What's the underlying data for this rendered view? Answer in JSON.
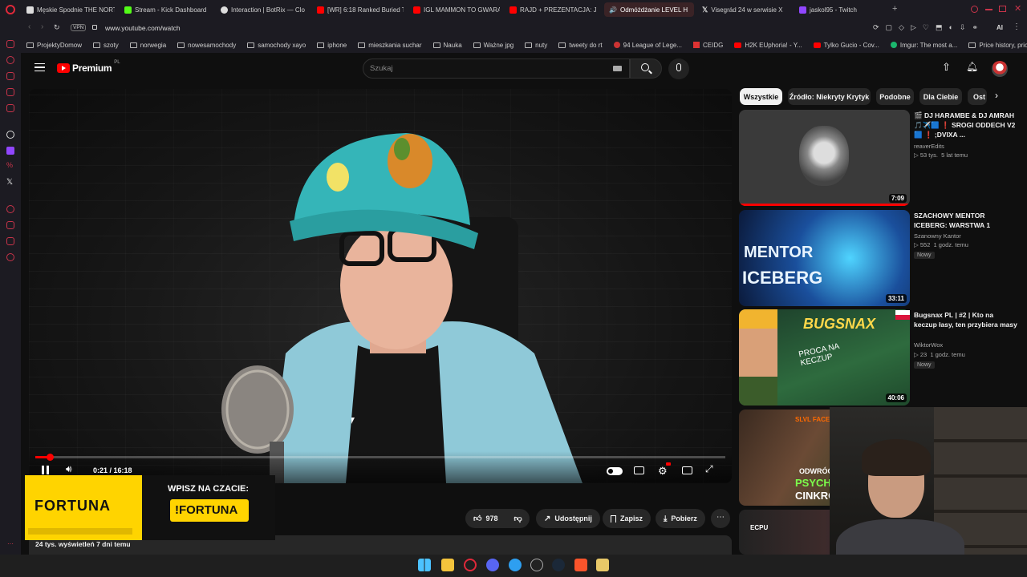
{
  "browser": {
    "tabs": [
      {
        "label": "Męskie Spodnie THE NORT",
        "color": "#222222"
      },
      {
        "label": "Stream - Kick Dashboard",
        "color": "#53fc18"
      },
      {
        "label": "Interaction | BotRix — Clo",
        "color": "#dddddd"
      },
      {
        "label": "[WR] 6:18 Ranked Buried T",
        "color": "#ff0000"
      },
      {
        "label": "IGL MAMMON TO GWARAN",
        "color": "#ff0000"
      },
      {
        "label": "RAJD + PREZENTACJA: Ja",
        "color": "#ff0000"
      },
      {
        "label": "Odmóżdżanie LEVEL H",
        "color": "#ff0000"
      },
      {
        "label": "Visegrád 24 w serwisie X",
        "color": "#ffffff"
      },
      {
        "label": "jaskol95 - Twitch",
        "color": "#9146ff"
      }
    ],
    "vpn_label": "VPN",
    "url": "www.youtube.com/watch",
    "ai_label": "AI",
    "bookmarks": [
      "ProjektyDomow",
      "szoty",
      "norwegia",
      "nowesamochody",
      "samochody xayo",
      "iphone",
      "mieszkania suchar",
      "Nauka",
      "Ważne jpg",
      "nuty",
      "tweety do rt",
      "94 League of Lege...",
      "CEIDG",
      "H2K EUphoria! - Y...",
      "Tylko Gucio - Cov...",
      "Imgur: The most a...",
      "Price history, price..."
    ]
  },
  "youtube": {
    "logo_text": "Premium",
    "logo_sup": "PL",
    "search_placeholder": "Szukaj",
    "player": {
      "time": "0:21 / 16:18",
      "progress": 0.0215
    },
    "chips": [
      "Wszystkie",
      "Źródło: Niekryty Krytyk",
      "Podobne",
      "Dla Ciebie",
      "Ost"
    ],
    "recommendations": [
      {
        "title": "🎬 DJ HARAMBE & DJ AMRAH 🎵✈️🟦 ❗ SROGI ODDECH V2🟦 ❗ ;DVIXA ...",
        "channel": "reaverEdits",
        "views": "53 tys.",
        "age": "5 lat temu",
        "duration": "7:09",
        "badge": ""
      },
      {
        "title": "SZACHOWY MENTOR ICEBERG: WARSTWA 1",
        "channel": "Szanowny Kantor",
        "views": "552",
        "age": "1 godz. temu",
        "duration": "33:11",
        "badge": "Nowy"
      },
      {
        "title": "Bugsnax PL | #2 | Kto na keczup łasy, ten przybiera masy",
        "channel": "WiktorWox",
        "views": "23",
        "age": "1 godz. temu",
        "duration": "40:06",
        "badge": "Nowy"
      }
    ],
    "thumb_texts": {
      "mentor_line1": "MENTOR",
      "mentor_line2": "ICEBERG",
      "bugsnax": "BUGSNAX",
      "bugsnax_sub": "PROCA NA KECZUP",
      "slvl": "SLVL FACEIT",
      "odwroc1": "ODWRÓCO",
      "odwroc2": "PSYCHOLO",
      "odwroc3": "CINKRO",
      "ecpu": "ECPU"
    },
    "actions": {
      "likes": "978",
      "share": "Udostępnij",
      "save": "Zapisz",
      "download": "Pobierz"
    },
    "meta": {
      "views_age": "24 tys. wyświetleń  7 dni temu"
    },
    "ad": {
      "brand": "FORTUNA",
      "cta_top": "WPISZ NA CZACIE:",
      "cta_cmd": "!FORTUNA"
    }
  },
  "colors": {
    "youtube_red": "#ff0000",
    "fortuna_yellow": "#ffd400",
    "hat_teal": "#35b5b8",
    "jacket_blue": "#8fc9d8"
  }
}
